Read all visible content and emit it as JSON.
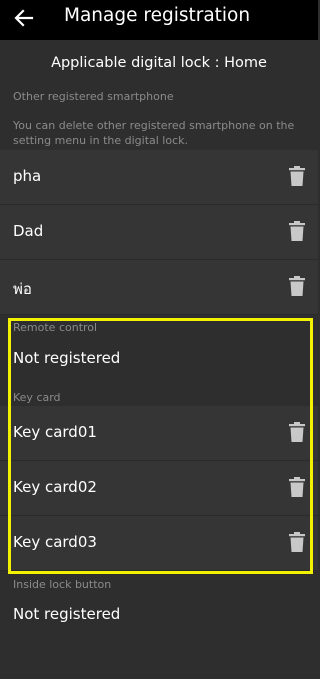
{
  "header": {
    "title": "Manage registration"
  },
  "subheader": {
    "lock_label": "Applicable digital lock : Home"
  },
  "smartphones": {
    "section_label": "Other registered smartphone",
    "note": "You can delete other registered smartphone on the setting menu in the digital lock.",
    "items": [
      {
        "label": "pha"
      },
      {
        "label": "Dad"
      },
      {
        "label": "พ่อ"
      }
    ]
  },
  "remote_control": {
    "section_label": "Remote control",
    "status": "Not registered"
  },
  "key_card": {
    "section_label": "Key card",
    "items": [
      {
        "label": "Key card01"
      },
      {
        "label": "Key card02"
      },
      {
        "label": "Key card03"
      }
    ]
  },
  "inside_lock_button": {
    "section_label": "Inside lock button",
    "status": "Not registered"
  },
  "colors": {
    "highlight_border": "#f2f200",
    "background": "#2e2e2e",
    "row_background": "#353535",
    "topbar": "#000000",
    "muted_text": "#8b8b8b"
  },
  "icons": {
    "back": "arrow-left-icon",
    "delete": "trash-icon"
  }
}
